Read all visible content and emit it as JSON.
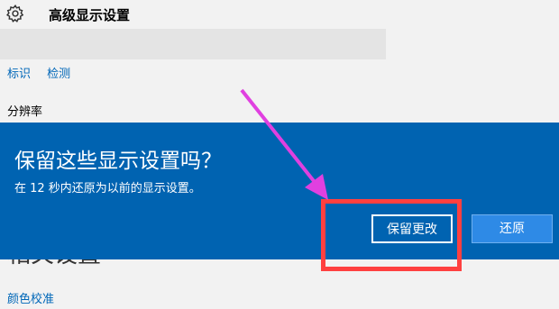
{
  "header": {
    "title": "高级显示设置",
    "icon": "gear-icon"
  },
  "links": {
    "identify": "标识",
    "detect": "检测"
  },
  "resolution": {
    "label": "分辨率"
  },
  "related": {
    "heading": "相关设置",
    "calibration": "颜色校准"
  },
  "dialog": {
    "title": "保留这些显示设置吗？",
    "message": "在 12 秒内还原为以前的显示设置。",
    "keep_label": "保留更改",
    "revert_label": "还原"
  },
  "colors": {
    "dialog_bg": "#0063b1",
    "highlight": "#ff4040",
    "arrow": "#e040e0",
    "link": "#0067b8"
  }
}
